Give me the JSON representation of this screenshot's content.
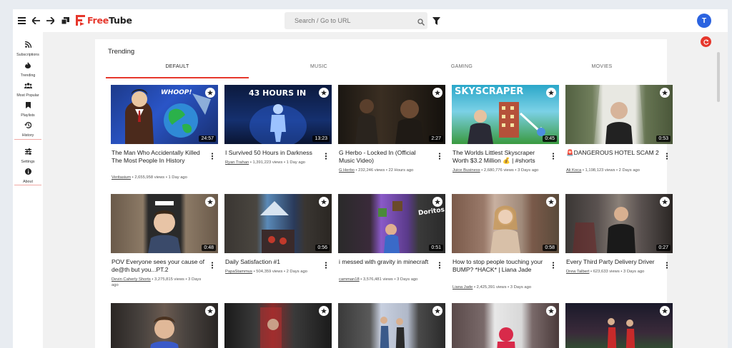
{
  "header": {
    "logo_free": "Free",
    "logo_tube": "Tube",
    "search_placeholder": "Search / Go to URL",
    "avatar_letter": "T"
  },
  "sidebar": {
    "items": [
      {
        "label": "Subscriptions",
        "icon": "rss-icon"
      },
      {
        "label": "Trending",
        "icon": "fire-icon"
      },
      {
        "label": "Most Popular",
        "icon": "users-icon"
      },
      {
        "label": "Playlists",
        "icon": "bookmark-icon"
      },
      {
        "label": "History",
        "icon": "history-icon"
      },
      {
        "label": "Settings",
        "icon": "sliders-icon"
      },
      {
        "label": "About",
        "icon": "info-icon"
      }
    ]
  },
  "page": {
    "title": "Trending",
    "tabs": [
      "DEFAULT",
      "MUSIC",
      "GAMING",
      "MOVIES"
    ],
    "active_tab": "DEFAULT"
  },
  "videos": [
    {
      "title": "The Man Who Accidentally Killed The Most People In History",
      "channel": "Veritasium",
      "meta": " • 2,655,958 views • 1 Day ago",
      "duration": "24:57",
      "thumb_text": "WHOOP!"
    },
    {
      "title": "I Survived 50 Hours in Darkness",
      "channel": "Ryan Trahan",
      "meta": " • 1,391,223 views • 1 Day ago",
      "duration": "13:23",
      "thumb_text": "43 HOURS IN"
    },
    {
      "title": "G Herbo - Locked In (Official Music Video)",
      "channel": "G Herbo",
      "meta": " • 232,246 views • 22 Hours ago",
      "duration": "2:27",
      "thumb_text": ""
    },
    {
      "title": "The Worlds Littlest Skyscraper Worth $3.2 Million 💰 | #shorts",
      "channel": "Juice Business",
      "meta": " • 2,680,776 views • 3 Days ago",
      "duration": "0:45",
      "thumb_text": "SKYSCRAPER"
    },
    {
      "title": "🚨DANGEROUS HOTEL SCAM 2",
      "channel": "Ali Koca",
      "meta": " • 1,198,123 views • 2 Days ago",
      "duration": "0:53",
      "thumb_text": ""
    },
    {
      "title": "POV Everyone sees your cause of de@th but you...PT.2",
      "channel": "Devin Caherly Shorts",
      "meta": " • 3,275,815 views • 3 Days ago",
      "duration": "0:48",
      "thumb_text": ""
    },
    {
      "title": "Daily Satisfaction #1",
      "channel": "PapaStammus",
      "meta": " • 504,359 views • 2 Days ago",
      "duration": "0:56",
      "thumb_text": ""
    },
    {
      "title": "i messed with gravity in minecraft",
      "channel": "camman18",
      "meta": " • 3,576,481 views • 3 Days ago",
      "duration": "0:51",
      "thumb_text": "Doritos"
    },
    {
      "title": "How to stop people touching your BUMP? *HACK* | Liana Jade",
      "channel": "Liana Jade",
      "meta": " • 2,425,391 views • 3 Days ago",
      "duration": "0:58",
      "thumb_text": ""
    },
    {
      "title": "Every Third Party Delivery Driver",
      "channel": "Drew Talbert",
      "meta": " • 623,633 views • 3 Days ago",
      "duration": "0:27",
      "thumb_text": ""
    }
  ],
  "colors": {
    "accent": "#e6372c",
    "avatar": "#2b63e0"
  }
}
